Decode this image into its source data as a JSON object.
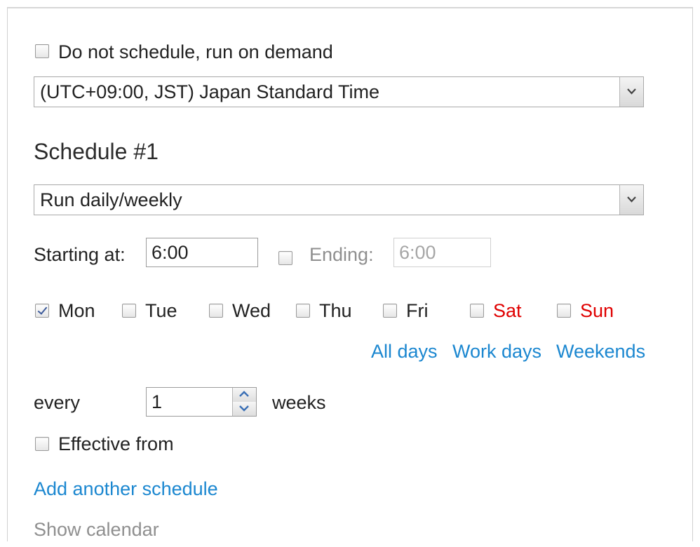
{
  "run_on_demand": {
    "label": "Do not schedule, run on demand",
    "checked": false
  },
  "timezone": {
    "selected": "(UTC+09:00, JST) Japan Standard Time",
    "arrow_icon": "chevron-down-icon"
  },
  "schedule": {
    "title": "Schedule #1",
    "mode": {
      "selected": "Run daily/weekly",
      "arrow_icon": "chevron-down-icon"
    },
    "starting": {
      "label": "Starting at:",
      "value": "6:00"
    },
    "ending": {
      "label": "Ending:",
      "value": "6:00",
      "checked": false,
      "disabled": true
    },
    "days": [
      {
        "label": "Mon",
        "checked": true,
        "weekend": false
      },
      {
        "label": "Tue",
        "checked": false,
        "weekend": false
      },
      {
        "label": "Wed",
        "checked": false,
        "weekend": false
      },
      {
        "label": "Thu",
        "checked": false,
        "weekend": false
      },
      {
        "label": "Fri",
        "checked": false,
        "weekend": false
      },
      {
        "label": "Sat",
        "checked": false,
        "weekend": true
      },
      {
        "label": "Sun",
        "checked": false,
        "weekend": true
      }
    ],
    "quick_select": {
      "all_days": "All days",
      "work_days": "Work days",
      "weekends": "Weekends"
    },
    "every": {
      "label": "every",
      "value": "1",
      "unit": "weeks"
    },
    "effective_from": {
      "label": "Effective from",
      "checked": false
    }
  },
  "links": {
    "add_schedule": "Add another schedule",
    "show_calendar": "Show calendar"
  },
  "colors": {
    "link": "#1b87d0",
    "weekend": "#e00000",
    "muted": "#8f8f8f"
  }
}
